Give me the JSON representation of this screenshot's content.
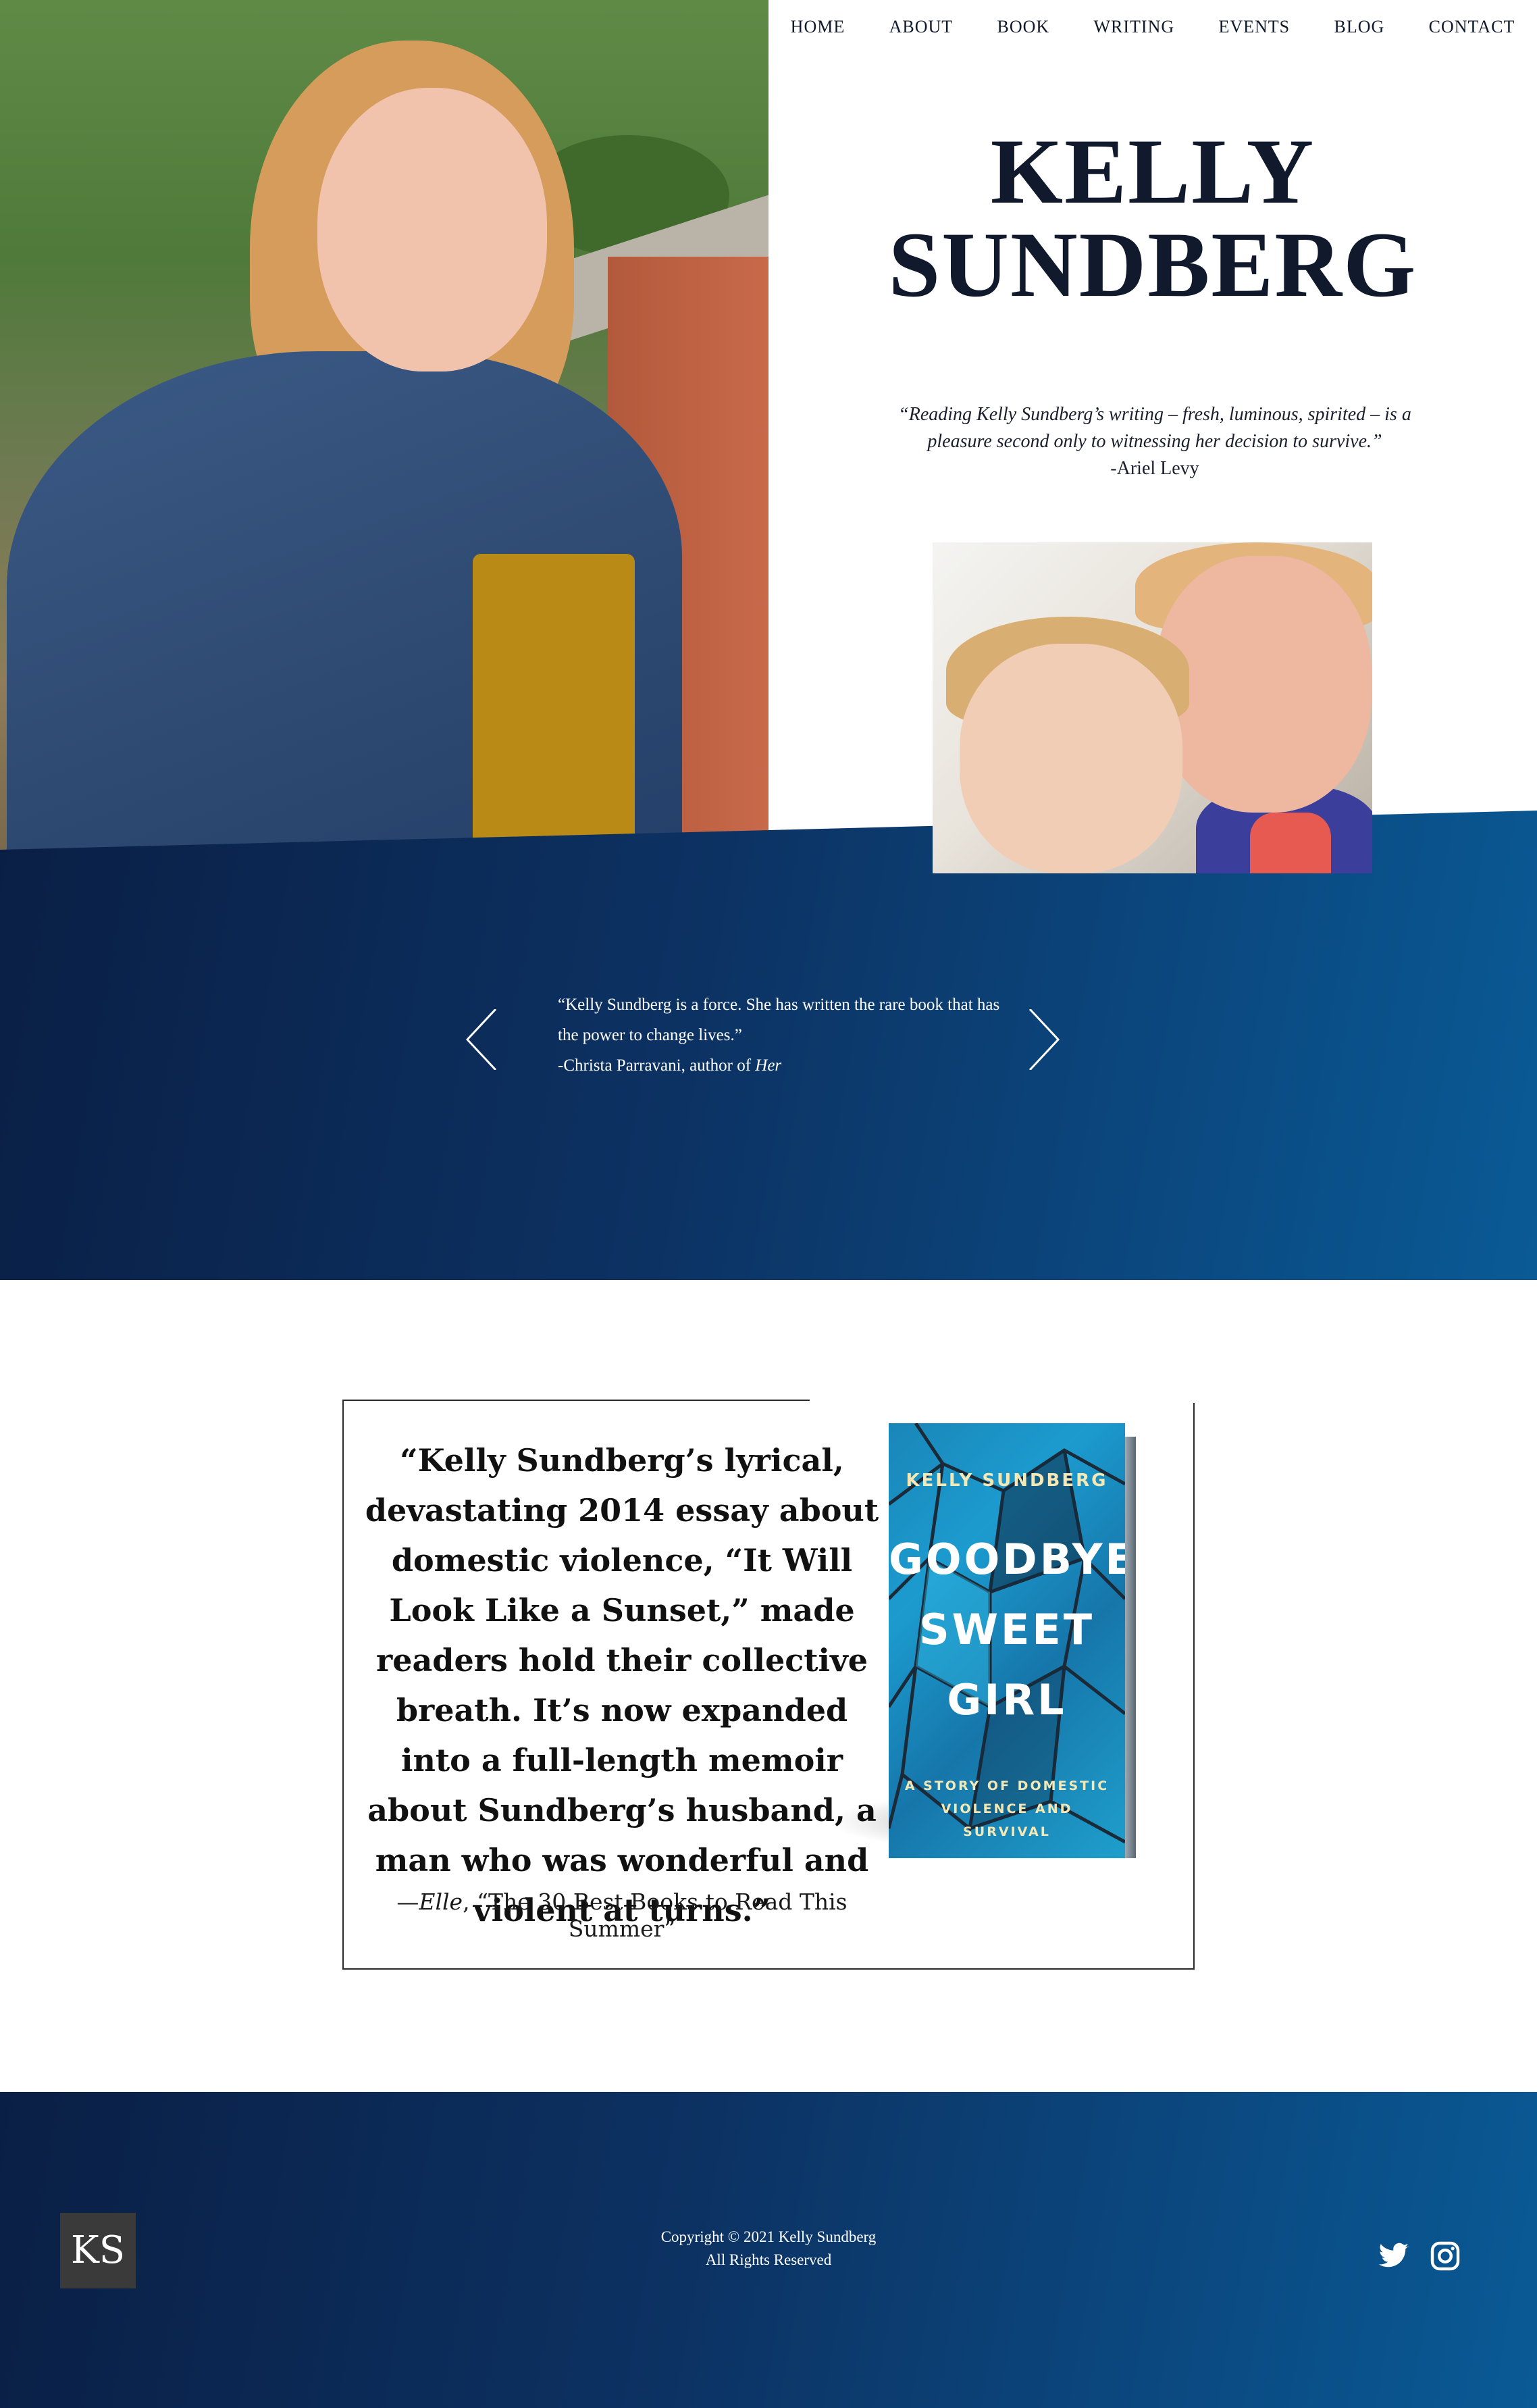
{
  "nav": {
    "items": [
      "HOME",
      "ABOUT",
      "BOOK",
      "WRITING",
      "EVENTS",
      "BLOG",
      "CONTACT"
    ]
  },
  "hero": {
    "title_line1": "KELLY",
    "title_line2": "SUNDBERG",
    "quote": "“Reading Kelly Sundberg’s writing – fresh, luminous, spirited – is a pleasure second only to witnessing her decision to survive.”",
    "quote_attribution": "-Ariel Levy"
  },
  "slider": {
    "quote": "“Kelly Sundberg is a force. She has written the rare book that has the power to change lives.”",
    "attribution_prefix": "-Christa Parravani, author of ",
    "attribution_book": "Her"
  },
  "book": {
    "quote": "“Kelly Sundberg’s lyrical, devastating 2014 essay about domestic violence, “It Will Look Like a Sunset,” made readers hold their collective breath. It’s now expanded into a full-length memoir about Sundberg’s husband, a man who was wonderful and violent at turns.”",
    "source_prefix": "—",
    "source_publication": "Elle",
    "source_suffix": ", “The 30 Best Books to Read This Summer”",
    "cover_author": "KELLY SUNDBERG",
    "cover_title": "GOODBYE,\nSWEET\nGIRL",
    "cover_subtitle": "A STORY OF DOMESTIC VIOLENCE AND SURVIVAL"
  },
  "footer": {
    "logo": "KS",
    "copyright_line1": "Copyright © 2021 Kelly Sundberg",
    "copyright_line2": "All Rights Reserved"
  },
  "colors": {
    "navy": "#111a2c",
    "band_dark": "#0a1f45",
    "band_light": "#0a5a96",
    "logo_bg": "#3a3a3a"
  },
  "icons": [
    "chevron-left-icon",
    "chevron-right-icon",
    "twitter-icon",
    "instagram-icon"
  ]
}
